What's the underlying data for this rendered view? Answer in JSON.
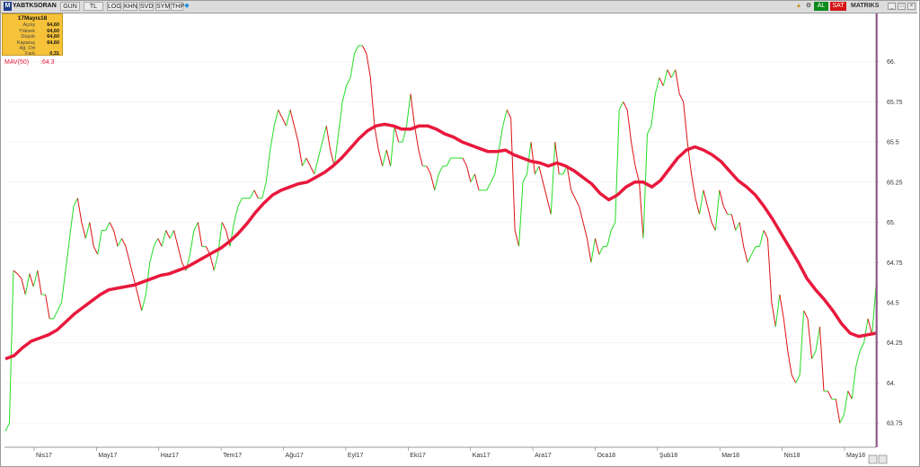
{
  "toolbar": {
    "logo": "M",
    "symbol": "YABTKSORAN",
    "period": "GUN",
    "currency": "TL",
    "buttons": [
      "LOG",
      "KHN",
      "SVD",
      "SYM",
      "THP"
    ],
    "buy_label": "AL",
    "sell_label": "SAT",
    "brand_label": "MATRIKS"
  },
  "info_box": {
    "date": "17Mayıs18",
    "rows": [
      {
        "label": "Açılış",
        "value": "64,60"
      },
      {
        "label": "Yüksek",
        "value": "64,60"
      },
      {
        "label": "Düşük",
        "value": "64,60"
      },
      {
        "label": "Kapanış",
        "value": "64,60"
      },
      {
        "label": "Ağ. Ort",
        "value": ""
      },
      {
        "label": "Fark",
        "value": "0,31"
      }
    ]
  },
  "indicator": {
    "label": "MAV(50)",
    "value": ":64.3"
  },
  "colors": {
    "up": "#22dd22",
    "down": "#dd1111",
    "mav": "#e8193c",
    "cursor": "#8a1d7a"
  },
  "chart_data": {
    "type": "line",
    "title": "",
    "ylim": [
      63.6,
      66.3
    ],
    "yticks": [
      {
        "value": 66.0,
        "label": "66."
      },
      {
        "value": 65.75,
        "label": "65.75"
      },
      {
        "value": 65.5,
        "label": "65.5"
      },
      {
        "value": 65.25,
        "label": "65.25"
      },
      {
        "value": 65.0,
        "label": "65."
      },
      {
        "value": 64.75,
        "label": "64.75"
      },
      {
        "value": 64.5,
        "label": "64.5"
      },
      {
        "value": 64.25,
        "label": "64.25"
      },
      {
        "value": 64.0,
        "label": "64."
      },
      {
        "value": 63.75,
        "label": "63.75"
      }
    ],
    "xticks": [
      "Nis17",
      "May17",
      "Haz17",
      "Tem17",
      "Ağu17",
      "Eyl17",
      "Eki17",
      "Kas17",
      "Ara17",
      "Oca18",
      "Şub18",
      "Mar18",
      "Nis18",
      "May18"
    ],
    "grid": true,
    "series": [
      {
        "name": "",
        "values": [
          63.7,
          63.75,
          64.7,
          64.68,
          64.65,
          64.55,
          64.68,
          64.6,
          64.7,
          64.55,
          64.55,
          64.4,
          64.4,
          64.45,
          64.5,
          64.7,
          64.9,
          65.1,
          65.15,
          65.0,
          64.9,
          65.0,
          64.85,
          64.8,
          64.95,
          64.95,
          65.0,
          64.95,
          64.85,
          64.9,
          64.85,
          64.75,
          64.65,
          64.55,
          64.45,
          64.55,
          64.75,
          64.85,
          64.9,
          64.85,
          64.95,
          64.9,
          64.95,
          64.85,
          64.75,
          64.7,
          64.8,
          64.95,
          65.0,
          64.85,
          64.85,
          64.8,
          64.7,
          64.8,
          65.0,
          64.95,
          64.85,
          65.0,
          65.1,
          65.15,
          65.15,
          65.15,
          65.2,
          65.15,
          65.15,
          65.25,
          65.45,
          65.6,
          65.7,
          65.65,
          65.6,
          65.7,
          65.6,
          65.5,
          65.35,
          65.4,
          65.35,
          65.3,
          65.4,
          65.5,
          65.6,
          65.45,
          65.35,
          65.55,
          65.75,
          65.85,
          65.9,
          66.05,
          66.1,
          66.1,
          66.05,
          65.9,
          65.6,
          65.45,
          65.35,
          65.45,
          65.35,
          65.6,
          65.5,
          65.5,
          65.6,
          65.8,
          65.6,
          65.45,
          65.35,
          65.35,
          65.3,
          65.2,
          65.3,
          65.35,
          65.35,
          65.4,
          65.4,
          65.4,
          65.4,
          65.35,
          65.25,
          65.3,
          65.2,
          65.2,
          65.2,
          65.25,
          65.3,
          65.45,
          65.6,
          65.7,
          65.65,
          64.95,
          64.85,
          65.25,
          65.3,
          65.5,
          65.3,
          65.35,
          65.25,
          65.15,
          65.05,
          65.5,
          65.3,
          65.3,
          65.35,
          65.2,
          65.15,
          65.1,
          65.0,
          64.9,
          64.75,
          64.9,
          64.8,
          64.85,
          64.85,
          64.95,
          65.0,
          65.7,
          65.75,
          65.7,
          65.5,
          65.35,
          65.25,
          64.9,
          65.55,
          65.6,
          65.8,
          65.9,
          65.85,
          65.95,
          65.9,
          65.95,
          65.8,
          65.75,
          65.5,
          65.3,
          65.15,
          65.05,
          65.2,
          65.1,
          65.0,
          64.95,
          65.2,
          65.1,
          65.05,
          65.05,
          64.95,
          65.0,
          64.85,
          64.75,
          64.8,
          64.85,
          64.85,
          64.95,
          64.9,
          64.5,
          64.35,
          64.55,
          64.4,
          64.2,
          64.05,
          64.0,
          64.05,
          64.45,
          64.4,
          64.15,
          64.2,
          64.35,
          63.95,
          63.95,
          63.9,
          63.9,
          63.75,
          63.8,
          63.95,
          63.9,
          64.1,
          64.2,
          64.25,
          64.4,
          64.3,
          64.6
        ]
      },
      {
        "name": "MAV(50)",
        "values": [
          64.15,
          64.17,
          64.22,
          64.26,
          64.28,
          64.3,
          64.33,
          64.38,
          64.43,
          64.47,
          64.51,
          64.55,
          64.58,
          64.59,
          64.6,
          64.61,
          64.63,
          64.65,
          64.67,
          64.68,
          64.7,
          64.72,
          64.75,
          64.78,
          64.81,
          64.84,
          64.88,
          64.93,
          64.99,
          65.06,
          65.12,
          65.17,
          65.2,
          65.22,
          65.24,
          65.25,
          65.28,
          65.31,
          65.35,
          65.4,
          65.46,
          65.52,
          65.57,
          65.6,
          65.61,
          65.6,
          65.58,
          65.58,
          65.6,
          65.6,
          65.58,
          65.55,
          65.53,
          65.5,
          65.48,
          65.46,
          65.44,
          65.44,
          65.45,
          65.42,
          65.4,
          65.38,
          65.37,
          65.35,
          65.37,
          65.35,
          65.32,
          65.28,
          65.24,
          65.18,
          65.14,
          65.17,
          65.22,
          65.25,
          65.25,
          65.22,
          65.26,
          65.33,
          65.4,
          65.45,
          65.47,
          65.45,
          65.42,
          65.38,
          65.32,
          65.26,
          65.22,
          65.17,
          65.1,
          65.02,
          64.93,
          64.84,
          64.75,
          64.65,
          64.58,
          64.52,
          64.45,
          64.37,
          64.31,
          64.29,
          64.3,
          64.31
        ]
      }
    ]
  }
}
